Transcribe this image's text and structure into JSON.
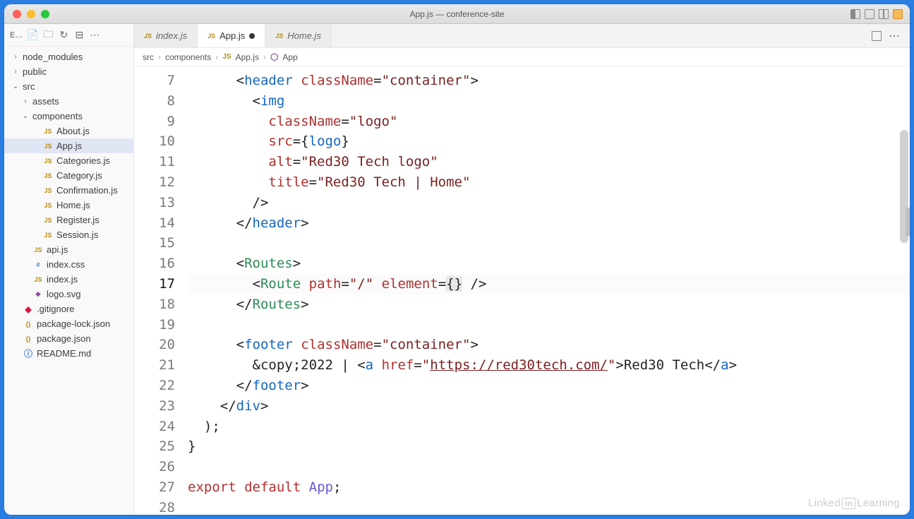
{
  "window": {
    "title": "App.js — conference-site"
  },
  "sidebar": {
    "header": "E…",
    "items": [
      {
        "name": "node_modules",
        "depth": 0,
        "arrow": "›",
        "icon": "",
        "iconClass": ""
      },
      {
        "name": "public",
        "depth": 0,
        "arrow": "›",
        "icon": "",
        "iconClass": ""
      },
      {
        "name": "src",
        "depth": 0,
        "arrow": "⌄",
        "icon": "",
        "iconClass": ""
      },
      {
        "name": "assets",
        "depth": 1,
        "arrow": "›",
        "icon": "",
        "iconClass": ""
      },
      {
        "name": "components",
        "depth": 1,
        "arrow": "⌄",
        "icon": "",
        "iconClass": ""
      },
      {
        "name": "About.js",
        "depth": 2,
        "arrow": "",
        "icon": "JS",
        "iconClass": "fi-js"
      },
      {
        "name": "App.js",
        "depth": 2,
        "arrow": "",
        "icon": "JS",
        "iconClass": "fi-js",
        "selected": true
      },
      {
        "name": "Categories.js",
        "depth": 2,
        "arrow": "",
        "icon": "JS",
        "iconClass": "fi-js"
      },
      {
        "name": "Category.js",
        "depth": 2,
        "arrow": "",
        "icon": "JS",
        "iconClass": "fi-js"
      },
      {
        "name": "Confirmation.js",
        "depth": 2,
        "arrow": "",
        "icon": "JS",
        "iconClass": "fi-js"
      },
      {
        "name": "Home.js",
        "depth": 2,
        "arrow": "",
        "icon": "JS",
        "iconClass": "fi-js"
      },
      {
        "name": "Register.js",
        "depth": 2,
        "arrow": "",
        "icon": "JS",
        "iconClass": "fi-js"
      },
      {
        "name": "Session.js",
        "depth": 2,
        "arrow": "",
        "icon": "JS",
        "iconClass": "fi-js"
      },
      {
        "name": "api.js",
        "depth": 1,
        "arrow": "",
        "icon": "JS",
        "iconClass": "fi-js"
      },
      {
        "name": "index.css",
        "depth": 1,
        "arrow": "",
        "icon": "#",
        "iconClass": "fi-css"
      },
      {
        "name": "index.js",
        "depth": 1,
        "arrow": "",
        "icon": "JS",
        "iconClass": "fi-js"
      },
      {
        "name": "logo.svg",
        "depth": 1,
        "arrow": "",
        "icon": "◆",
        "iconClass": "fi-svg"
      },
      {
        "name": ".gitignore",
        "depth": 0,
        "arrow": "",
        "icon": "◆",
        "iconClass": "fi-git"
      },
      {
        "name": "package-lock.json",
        "depth": 0,
        "arrow": "",
        "icon": "{}",
        "iconClass": "fi-json"
      },
      {
        "name": "package.json",
        "depth": 0,
        "arrow": "",
        "icon": "{}",
        "iconClass": "fi-json"
      },
      {
        "name": "README.md",
        "depth": 0,
        "arrow": "",
        "icon": "ⓘ",
        "iconClass": "fi-info"
      }
    ]
  },
  "tabs": [
    {
      "label": "index.js",
      "icon": "JS"
    },
    {
      "label": "App.js",
      "icon": "JS",
      "active": true,
      "dirty": true
    },
    {
      "label": "Home.js",
      "icon": "JS"
    }
  ],
  "breadcrumbs": [
    {
      "label": "src"
    },
    {
      "label": "components"
    },
    {
      "label": "App.js",
      "icon": "JS",
      "iconClass": "js"
    },
    {
      "label": "App",
      "icon": "⬡",
      "iconClass": "mod"
    }
  ],
  "code": {
    "startLine": 7,
    "currentLine": 17,
    "lines": [
      {
        "n": 7,
        "html": "      <span class='t-op'>&lt;</span><span class='t-tag'>header</span> <span class='t-attr'>className</span><span class='t-op'>=</span><span class='t-str'>\"container\"</span><span class='t-op'>&gt;</span>"
      },
      {
        "n": 8,
        "html": "        <span class='t-op'>&lt;</span><span class='t-tag'>img</span>"
      },
      {
        "n": 9,
        "html": "          <span class='t-attr'>className</span><span class='t-op'>=</span><span class='t-str'>\"logo\"</span>"
      },
      {
        "n": 10,
        "html": "          <span class='t-attr'>src</span><span class='t-op'>=</span><span class='t-op'>{</span><span class='t-var'>logo</span><span class='t-op'>}</span>"
      },
      {
        "n": 11,
        "html": "          <span class='t-attr'>alt</span><span class='t-op'>=</span><span class='t-str'>\"Red30 Tech logo\"</span>"
      },
      {
        "n": 12,
        "html": "          <span class='t-attr'>title</span><span class='t-op'>=</span><span class='t-str'>\"Red30 Tech | Home\"</span>"
      },
      {
        "n": 13,
        "html": "        <span class='t-op'>/&gt;</span>"
      },
      {
        "n": 14,
        "html": "      <span class='t-op'>&lt;/</span><span class='t-tag'>header</span><span class='t-op'>&gt;</span>"
      },
      {
        "n": 15,
        "html": ""
      },
      {
        "n": 16,
        "html": "      <span class='t-op'>&lt;</span><span class='t-comp'>Routes</span><span class='t-op'>&gt;</span>"
      },
      {
        "n": 17,
        "html": "        <span class='t-op'>&lt;</span><span class='t-comp'>Route</span> <span class='t-attr'>path</span><span class='t-op'>=</span><span class='t-str'>\"/\"</span> <span class='t-attr'>element</span><span class='t-op'>=</span><span class='t-bracket-hl'>{</span><span class='t-bracket-hl'>}</span> <span class='t-op'>/&gt;</span>"
      },
      {
        "n": 18,
        "html": "      <span class='t-op'>&lt;/</span><span class='t-comp'>Routes</span><span class='t-op'>&gt;</span>"
      },
      {
        "n": 19,
        "html": ""
      },
      {
        "n": 20,
        "html": "      <span class='t-op'>&lt;</span><span class='t-tag'>footer</span> <span class='t-attr'>className</span><span class='t-op'>=</span><span class='t-str'>\"container\"</span><span class='t-op'>&gt;</span>"
      },
      {
        "n": 21,
        "html": "        &amp;copy;2022 | <span class='t-op'>&lt;</span><span class='t-tag'>a</span> <span class='t-attr'>href</span><span class='t-op'>=</span><span class='t-str'>\"<span class='t-url'>https://red30tech.com/</span>\"</span><span class='t-op'>&gt;</span>Red30 Tech<span class='t-op'>&lt;/</span><span class='t-tag'>a</span><span class='t-op'>&gt;</span>"
      },
      {
        "n": 22,
        "html": "      <span class='t-op'>&lt;/</span><span class='t-tag'>footer</span><span class='t-op'>&gt;</span>"
      },
      {
        "n": 23,
        "html": "    <span class='t-op'>&lt;/</span><span class='t-tag'>div</span><span class='t-op'>&gt;</span>"
      },
      {
        "n": 24,
        "html": "  );"
      },
      {
        "n": 25,
        "html": "}"
      },
      {
        "n": 26,
        "html": ""
      },
      {
        "n": 27,
        "html": "<span class='t-kw'>export</span> <span class='t-kw'>default</span> <span class='t-fn'>App</span>;"
      },
      {
        "n": 28,
        "html": ""
      }
    ]
  },
  "watermark": "Linked in Learning"
}
